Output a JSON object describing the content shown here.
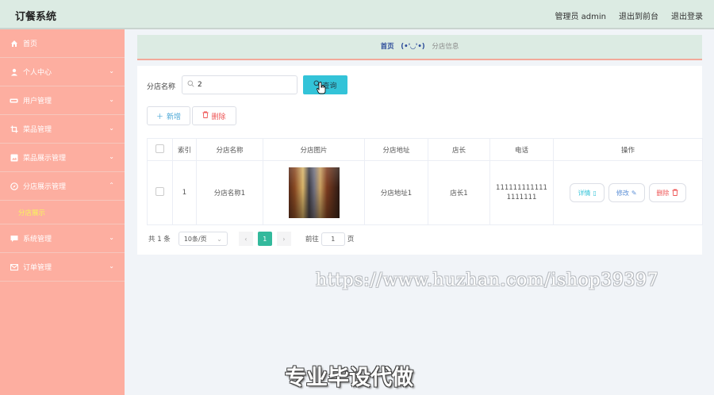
{
  "app": {
    "title": "订餐系统"
  },
  "header": {
    "admin_label": "管理员 admin",
    "frontend_link": "退出到前台",
    "logout_link": "退出登录"
  },
  "sidebar": {
    "items": [
      {
        "label": "首页",
        "icon": "home-icon"
      },
      {
        "label": "个人中心",
        "icon": "user-icon"
      },
      {
        "label": "用户管理",
        "icon": "users-icon"
      },
      {
        "label": "菜品管理",
        "icon": "crop-icon"
      },
      {
        "label": "菜品展示管理",
        "icon": "image-icon"
      },
      {
        "label": "分店展示管理",
        "icon": "compass-icon"
      },
      {
        "label": "系统管理",
        "icon": "chat-icon"
      },
      {
        "label": "订单管理",
        "icon": "mail-icon"
      }
    ],
    "submenu": {
      "label": "分店展示"
    }
  },
  "breadcrumb": {
    "home": "首页",
    "face": "(•'◡'•)",
    "current": "分店信息"
  },
  "search": {
    "label": "分店名称",
    "value": "2",
    "query_button": "查询"
  },
  "actions": {
    "add": "新增",
    "delete": "删除"
  },
  "table": {
    "headers": [
      "索引",
      "分店名称",
      "分店图片",
      "分店地址",
      "店长",
      "电话",
      "操作"
    ],
    "rows": [
      {
        "index": "1",
        "name": "分店名称1",
        "address": "分店地址1",
        "manager": "店长1",
        "phone": "1111111111111111111"
      }
    ],
    "ops": {
      "detail": "详情",
      "edit": "修改",
      "delete": "删除"
    }
  },
  "pagination": {
    "total": "共 1 条",
    "page_size": "10条/页",
    "current_page": "1",
    "goto_label": "前往",
    "goto_value": "1",
    "page_suffix": "页"
  },
  "watermark": "https://www.huzhan.com/ishop39397",
  "bottom_text": "专业毕设代做",
  "colors": {
    "sidebar": "#fdaea0",
    "header": "#dcebe3",
    "accent": "#33c3d8",
    "pager_active": "#33b99c"
  }
}
